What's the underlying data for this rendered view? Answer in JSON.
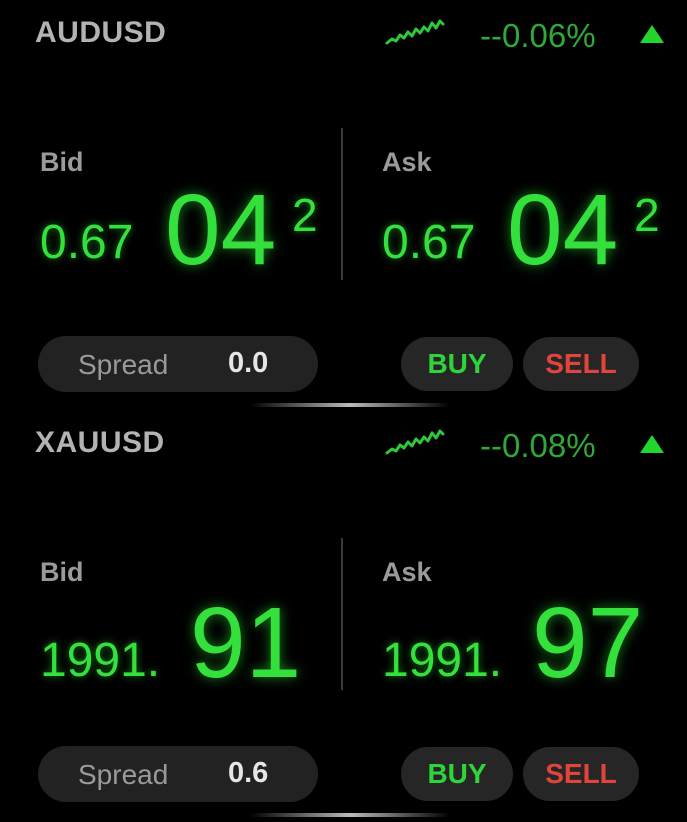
{
  "colors": {
    "background": "#000000",
    "price_green": "#33e03c",
    "change_green": "#2fa83a",
    "sell_red": "#e0443a",
    "pill_bg": "#222222"
  },
  "instruments": [
    {
      "symbol": "AUDUSD",
      "sparkline_icon": "sparkline-up-icon",
      "change": "--0.06%",
      "trend_icon": "triangle-up-icon",
      "bid": {
        "label": "Bid",
        "prefix": "0.67",
        "big": "04",
        "pip": "2"
      },
      "ask": {
        "label": "Ask",
        "prefix": "0.67",
        "big": "04",
        "pip": "2"
      },
      "spread": {
        "label": "Spread",
        "value": "0.0"
      },
      "buy_label": "BUY",
      "sell_label": "SELL"
    },
    {
      "symbol": "XAUUSD",
      "sparkline_icon": "sparkline-up-icon",
      "change": "--0.08%",
      "trend_icon": "triangle-up-icon",
      "bid": {
        "label": "Bid",
        "prefix": "1991.",
        "big": "91",
        "pip": ""
      },
      "ask": {
        "label": "Ask",
        "prefix": "1991.",
        "big": "97",
        "pip": ""
      },
      "spread": {
        "label": "Spread",
        "value": "0.6"
      },
      "buy_label": "BUY",
      "sell_label": "SELL"
    }
  ]
}
